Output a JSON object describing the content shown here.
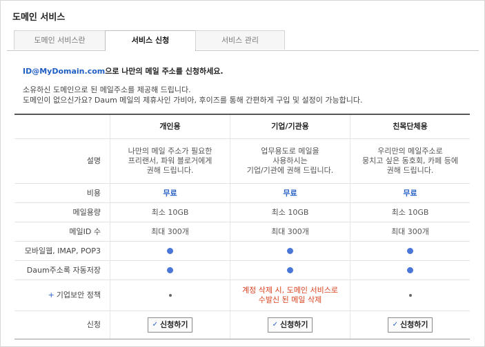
{
  "page": {
    "title": "도메인 서비스"
  },
  "tabs": [
    {
      "label": "도메인 서비스란"
    },
    {
      "label": "서비스 신청"
    },
    {
      "label": "서비스 관리"
    }
  ],
  "intro": {
    "domain": "ID@MyDomain.com",
    "heading_rest": "으로 나만의 메일 주소를 신청하세요.",
    "line1": "소유하신 도메인으로 된 메일주소를 제공해 드립니다.",
    "line2": "도메인이 없으신가요? Daum 메일의 제휴사인 가비아, 후이즈를 통해 간편하게 구입 및 설정이 가능합니다."
  },
  "table": {
    "columns": [
      "개인용",
      "기업/기관용",
      "친목단체용"
    ],
    "rows": {
      "description": {
        "label": "설명",
        "values": [
          [
            "나만의 메일 주소가 필요한",
            "프리랜서, 파워 블로거에게",
            "권해 드립니다."
          ],
          [
            "업무용도로 메일을",
            "사용하시는",
            "기업/기관에 권해 드립니다."
          ],
          [
            "우리만의 메일주소로",
            "뭉치고 싶은 동호회, 카페 등에",
            "권해 드립니다."
          ]
        ]
      },
      "cost": {
        "label": "비용",
        "values": [
          "무료",
          "무료",
          "무료"
        ]
      },
      "capacity": {
        "label": "메일용량",
        "values": [
          "최소 10GB",
          "최소 10GB",
          "최소 10GB"
        ]
      },
      "ids": {
        "label": "메일ID 수",
        "values": [
          "최대 300개",
          "최대 300개",
          "최대 300개"
        ]
      },
      "mobile": {
        "label": "모바일웹, IMAP, POP3"
      },
      "autosave": {
        "label": "Daum주소록 자동저장"
      },
      "security": {
        "plus": "+",
        "label": "기업보안 정책",
        "note_line1": "계정 삭제 시, 도메인 서비스로",
        "note_line2": "수발신 된 메일 삭제"
      },
      "apply": {
        "label": "신청",
        "button": "신청하기",
        "check": "✓"
      }
    }
  }
}
